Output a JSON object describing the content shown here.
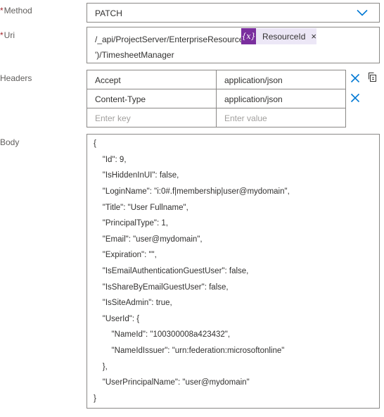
{
  "method": {
    "label": "Method",
    "required_mark": "*",
    "value": "PATCH",
    "dropdown_icon": "chevron-down-icon"
  },
  "uri": {
    "label": "Uri",
    "required_mark": "*",
    "line1_prefix": "/_api/ProjectServer/EnterpriseResources('",
    "token": {
      "icon_text": "{x}",
      "label": "ResourceId",
      "remove": "×"
    },
    "line2": "')/TimesheetManager"
  },
  "headers": {
    "label": "Headers",
    "rows": [
      {
        "key": "Accept",
        "value": "application/json"
      },
      {
        "key": "Content-Type",
        "value": "application/json"
      }
    ],
    "key_placeholder": "Enter key",
    "value_placeholder": "Enter value"
  },
  "body": {
    "label": "Body",
    "lines": [
      "{",
      "    \"Id\": 9,",
      "    \"IsHiddenInUI\": false,",
      "    \"LoginName\": \"i:0#.f|membership|user@mydomain\",",
      "    \"Title\": \"User Fullname\",",
      "    \"PrincipalType\": 1,",
      "    \"Email\": \"user@mydomain\",",
      "    \"Expiration\": \"\",",
      "    \"IsEmailAuthenticationGuestUser\": false,",
      "    \"IsShareByEmailGuestUser\": false,",
      "    \"IsSiteAdmin\": true,",
      "    \"UserId\": {",
      "        \"NameId\": \"100300008a423432\",",
      "        \"NameIdIssuer\": \"urn:federation:microsoftonline\"",
      "    },",
      "    \"UserPrincipalName\": \"user@mydomain\"",
      "}"
    ]
  },
  "colors": {
    "accent": "#0078d4",
    "token_icon_bg": "#7a2e9e",
    "token_bg": "#ece7f6",
    "required": "#a4262c"
  }
}
